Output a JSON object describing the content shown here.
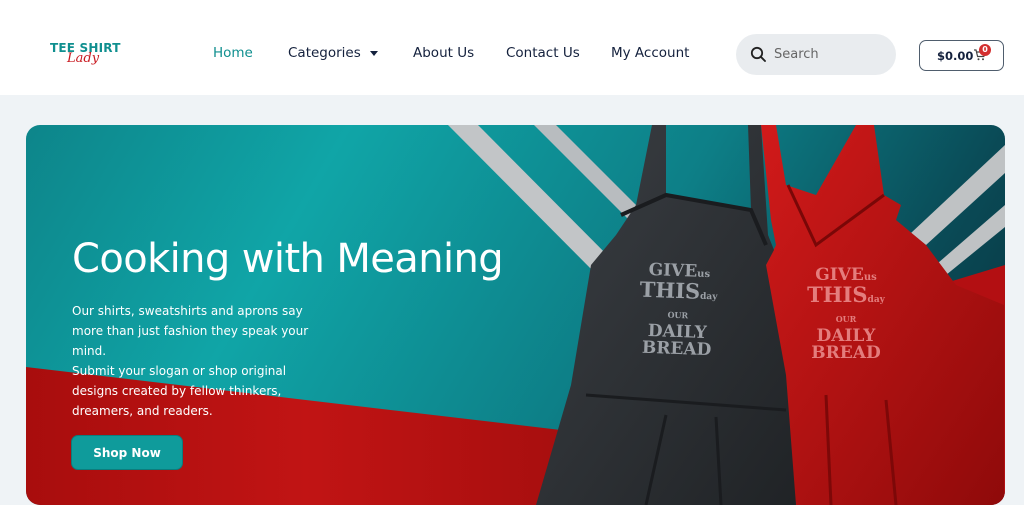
{
  "logo": {
    "line1": "TEE SHIRT",
    "line2": "Lady"
  },
  "nav": {
    "items": [
      {
        "label": "Home",
        "active": true
      },
      {
        "label": "Categories",
        "has_dropdown": true
      },
      {
        "label": "About Us"
      },
      {
        "label": "Contact Us"
      },
      {
        "label": "My Account"
      }
    ]
  },
  "search": {
    "placeholder": "Search",
    "icon": "search-icon"
  },
  "cart": {
    "amount": "$0.00",
    "count": "0",
    "icon": "cart-icon"
  },
  "hero": {
    "title": "Cooking with Meaning",
    "description_1": "Our shirts, sweatshirts and aprons say more than just fashion they speak your mind.",
    "description_2": "Submit your slogan or shop original designs created by fellow thinkers, dreamers, and readers.",
    "cta_label": "Shop Now",
    "apron_slogan": [
      "GIVE",
      "us",
      "THIS",
      "day",
      "OUR",
      "DAILY",
      "BREAD"
    ]
  },
  "colors": {
    "accent": "#0f9b9b",
    "brand_red": "#c8181f",
    "hero_red": "#b20f0f",
    "text_dark": "#14213d"
  }
}
